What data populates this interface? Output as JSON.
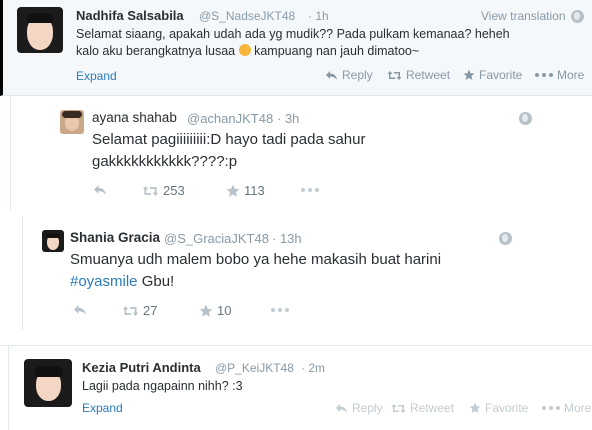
{
  "tweet1": {
    "name": "Nadhifa Salsabila",
    "handle": "@S_NadseJKT48",
    "time": "· 1h",
    "view_translation": "View translation",
    "text_line1": "Selamat siaang, apakah udah ada yg mudik?? Pada pulkam kemanaa? heheh",
    "text_line2a": "kalo aku berangkatnya lusaa",
    "text_line2b": "kampuang nan jauh dimatoo~",
    "expand": "Expand",
    "reply": "Reply",
    "retweet": "Retweet",
    "favorite": "Favorite",
    "more": "More"
  },
  "tweet2": {
    "name": "ayana shahab",
    "handle": "@achanJKT48",
    "time": "· 3h",
    "text_line1": "Selamat pagiiiiiiiii:D hayo tadi pada sahur",
    "text_line2": "gakkkkkkkkkkk????:p",
    "retweets": "253",
    "favorites": "113"
  },
  "tweet3": {
    "name": "Shania Gracia",
    "handle": "@S_GraciaJKT48",
    "time": "· 13h",
    "text_line1": "Smuanya udh malem bobo ya hehe makasih buat harini",
    "hashtag": "#oyasmile",
    "text_line2_rest": " Gbu!",
    "retweets": "27",
    "favorites": "10"
  },
  "tweet4": {
    "name": "Kezia Putri Andinta",
    "handle": "@P_KeiJKT48",
    "time": "· 2m",
    "text": "Lagii pada ngapainn nihh? :3",
    "expand": "Expand",
    "reply": "Reply",
    "retweet": "Retweet",
    "favorite": "Favorite",
    "more": "More"
  },
  "colors": {
    "link": "#2b7bb9",
    "muted": "#8899a6",
    "highlight_bg": "#f5f8fa"
  }
}
